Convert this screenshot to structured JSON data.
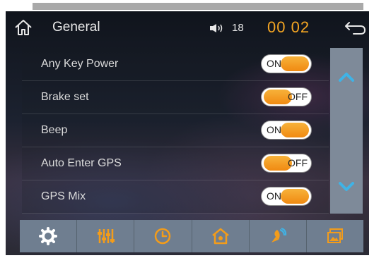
{
  "header": {
    "title": "General",
    "volume": "18",
    "clock": "00 02",
    "icons": {
      "home": "home-icon",
      "volume": "speaker-icon",
      "back": "back-arrow-icon"
    }
  },
  "settings": [
    {
      "label": "Any Key Power",
      "state": "ON"
    },
    {
      "label": "Brake set",
      "state": "OFF"
    },
    {
      "label": "Beep",
      "state": "ON"
    },
    {
      "label": "Auto Enter GPS",
      "state": "OFF"
    },
    {
      "label": "GPS Mix",
      "state": "ON"
    }
  ],
  "bottom_tabs": [
    {
      "icon": "gear-icon"
    },
    {
      "icon": "equalizer-icon"
    },
    {
      "icon": "clock-icon"
    },
    {
      "icon": "house-settings-icon"
    },
    {
      "icon": "satellite-icon"
    },
    {
      "icon": "picture-icon"
    }
  ],
  "colors": {
    "accent": "#f5a623",
    "toggle_knob": "#f39c1a",
    "scroll": "#7e8a99",
    "tabbar": "#6f7e90",
    "arrow": "#3fb3e6"
  }
}
